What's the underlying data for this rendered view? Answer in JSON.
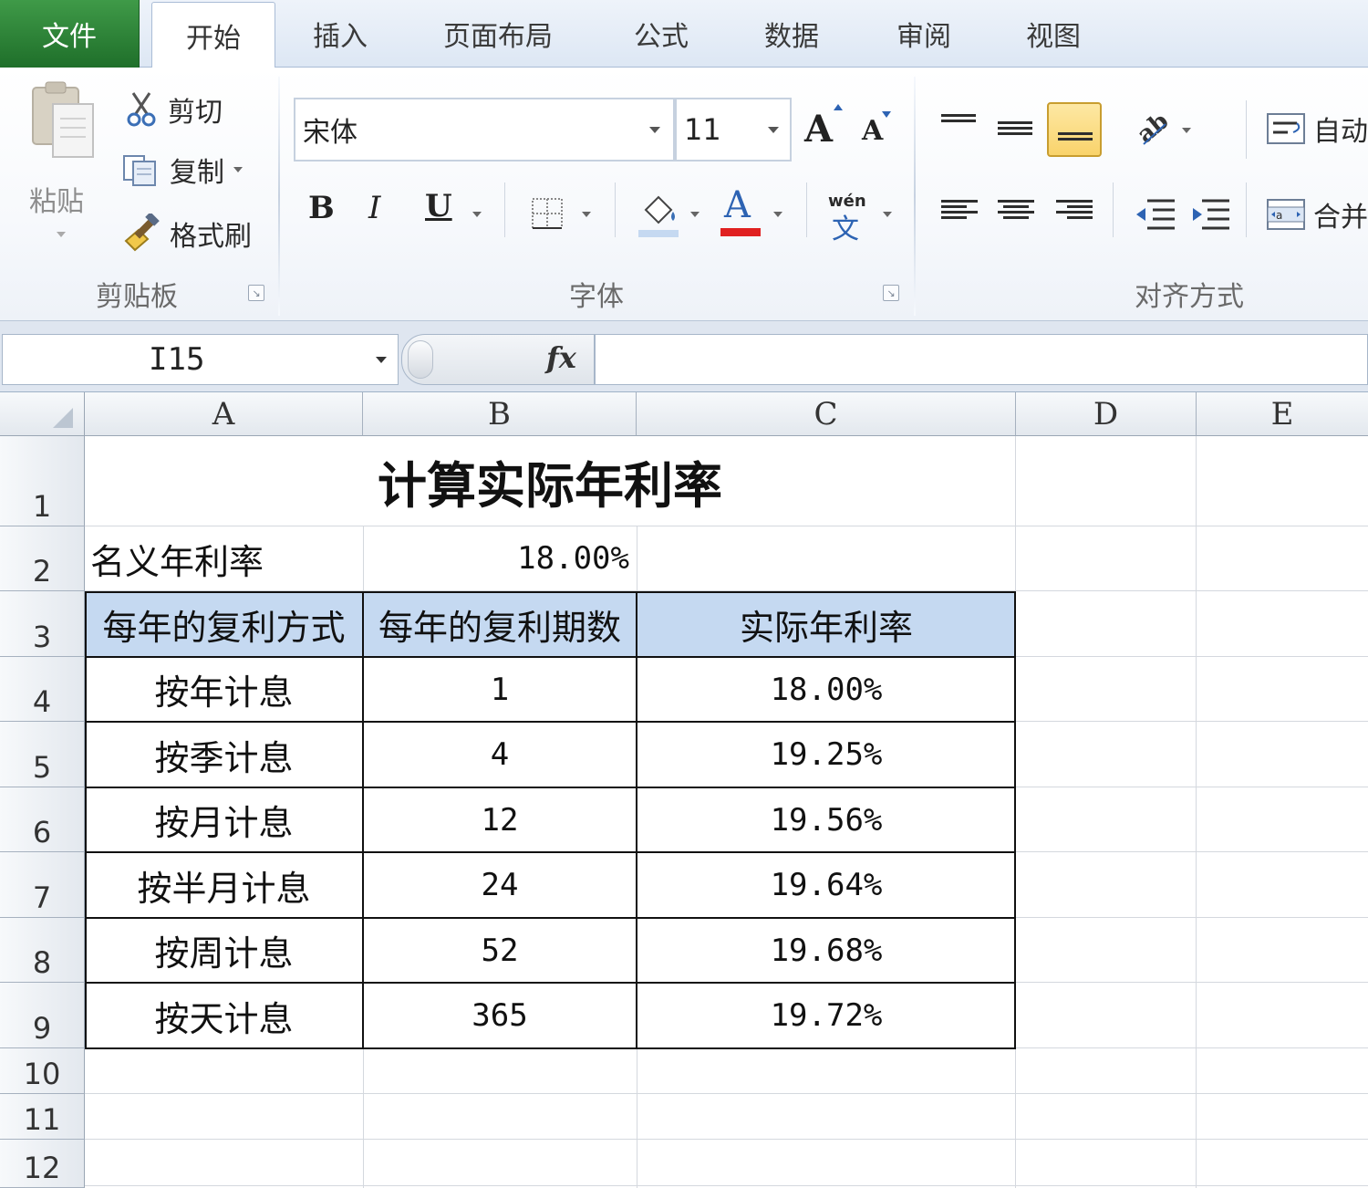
{
  "tabs": {
    "file": "文件",
    "home": "开始",
    "insert": "插入",
    "page_layout": "页面布局",
    "formulas": "公式",
    "data": "数据",
    "review": "审阅",
    "view": "视图"
  },
  "clipboard": {
    "paste": "粘贴",
    "cut": "剪切",
    "copy": "复制",
    "format_painter": "格式刷",
    "group_label": "剪贴板"
  },
  "font": {
    "font_name": "宋体",
    "font_size": "11",
    "bold": "B",
    "italic": "I",
    "underline": "U",
    "grow": "A",
    "shrink": "A",
    "font_color_glyph": "A",
    "phonetic_top": "wén",
    "phonetic_bottom": "文",
    "group_label": "字体"
  },
  "alignment": {
    "wrap_text": "自动",
    "merge": "合并",
    "group_label": "对齐方式"
  },
  "colors": {
    "font_color_bar": "#e02020",
    "fill_color_bar": "#c5d9f1",
    "active_button": "#f9d36b",
    "table_header": "#c5d9f1"
  },
  "formula_bar": {
    "name_box": "I15",
    "fx": "fx",
    "formula": ""
  },
  "sheet": {
    "columns": [
      "A",
      "B",
      "C",
      "D",
      "E"
    ],
    "rows": [
      "1",
      "2",
      "3",
      "4",
      "5",
      "6",
      "7",
      "8",
      "9",
      "10",
      "11",
      "12"
    ],
    "title": "计算实际年利率",
    "nominal_label": "名义年利率",
    "nominal_value": "18.00%",
    "headers": [
      "每年的复利方式",
      "每年的复利期数",
      "实际年利率"
    ],
    "table": [
      {
        "method": "按年计息",
        "periods": "1",
        "rate": "18.00%"
      },
      {
        "method": "按季计息",
        "periods": "4",
        "rate": "19.25%"
      },
      {
        "method": "按月计息",
        "periods": "12",
        "rate": "19.56%"
      },
      {
        "method": "按半月计息",
        "periods": "24",
        "rate": "19.64%"
      },
      {
        "method": "按周计息",
        "periods": "52",
        "rate": "19.68%"
      },
      {
        "method": "按天计息",
        "periods": "365",
        "rate": "19.72%"
      }
    ]
  }
}
